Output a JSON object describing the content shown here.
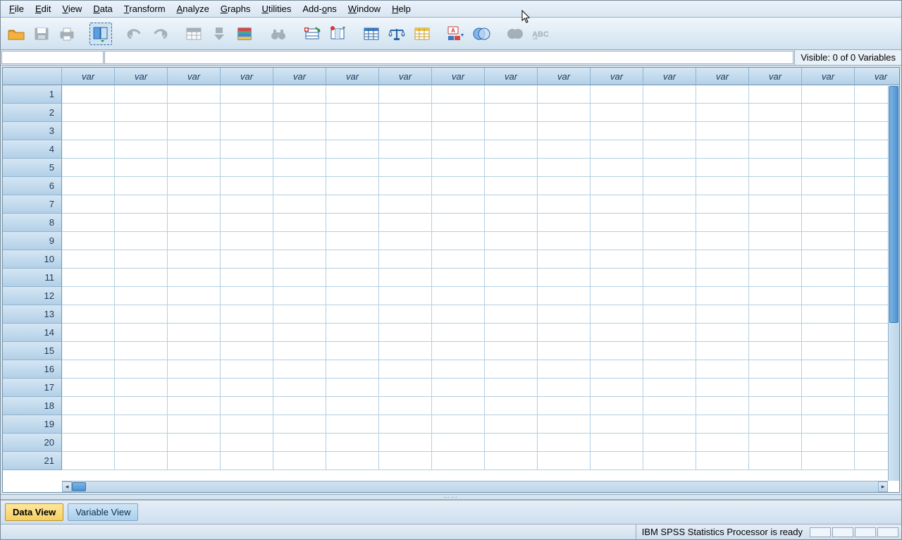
{
  "menu": {
    "items": [
      {
        "hotkey": "F",
        "rest": "ile"
      },
      {
        "hotkey": "E",
        "rest": "dit"
      },
      {
        "hotkey": "V",
        "rest": "iew"
      },
      {
        "hotkey": "D",
        "rest": "ata"
      },
      {
        "hotkey": "T",
        "rest": "ransform"
      },
      {
        "hotkey": "A",
        "rest": "nalyze"
      },
      {
        "hotkey": "G",
        "rest": "raphs"
      },
      {
        "hotkey": "U",
        "rest": "tilities"
      },
      {
        "hotkey": "",
        "rest": "Add-ons",
        "hotkey2": "o",
        "pre": "Add-",
        "post": "ns"
      },
      {
        "hotkey": "W",
        "rest": "indow"
      },
      {
        "hotkey": "H",
        "rest": "elp"
      }
    ]
  },
  "toolbar": {
    "icons": [
      {
        "name": "open-file-icon",
        "type": "folder",
        "disabled": false
      },
      {
        "name": "save-icon",
        "type": "disk",
        "disabled": true
      },
      {
        "name": "print-icon",
        "type": "printer",
        "disabled": true
      },
      {
        "name": "recall-dialog-icon",
        "type": "dialog-recall",
        "disabled": false,
        "selected": true
      },
      {
        "name": "undo-icon",
        "type": "undo",
        "disabled": true
      },
      {
        "name": "redo-icon",
        "type": "redo",
        "disabled": true
      },
      {
        "name": "goto-case-icon",
        "type": "grid-goto",
        "disabled": true
      },
      {
        "name": "goto-variable-icon",
        "type": "arrow-down",
        "disabled": true
      },
      {
        "name": "variables-icon",
        "type": "list-colored",
        "disabled": false
      },
      {
        "name": "find-icon",
        "type": "binoculars",
        "disabled": true
      },
      {
        "name": "insert-cases-icon",
        "type": "insert-case",
        "disabled": false
      },
      {
        "name": "insert-variable-icon",
        "type": "insert-var",
        "disabled": false
      },
      {
        "name": "split-file-icon",
        "type": "grid-split",
        "disabled": false
      },
      {
        "name": "weight-cases-icon",
        "type": "scale",
        "disabled": false
      },
      {
        "name": "select-cases-icon",
        "type": "grid-select",
        "disabled": false
      },
      {
        "name": "value-labels-icon",
        "type": "label-a",
        "disabled": false
      },
      {
        "name": "use-sets-icon",
        "type": "venn",
        "disabled": false
      },
      {
        "name": "show-all-icon",
        "type": "circles-grey",
        "disabled": true
      },
      {
        "name": "spell-check-icon",
        "type": "abc",
        "disabled": true
      }
    ]
  },
  "inforow": {
    "visible_text": "Visible: 0 of 0 Variables"
  },
  "grid": {
    "column_header": "var",
    "num_columns": 16,
    "num_rows": 21
  },
  "viewtabs": {
    "data_view": "Data View",
    "variable_view": "Variable View"
  },
  "statusbar": {
    "message": "IBM SPSS Statistics Processor is ready"
  }
}
